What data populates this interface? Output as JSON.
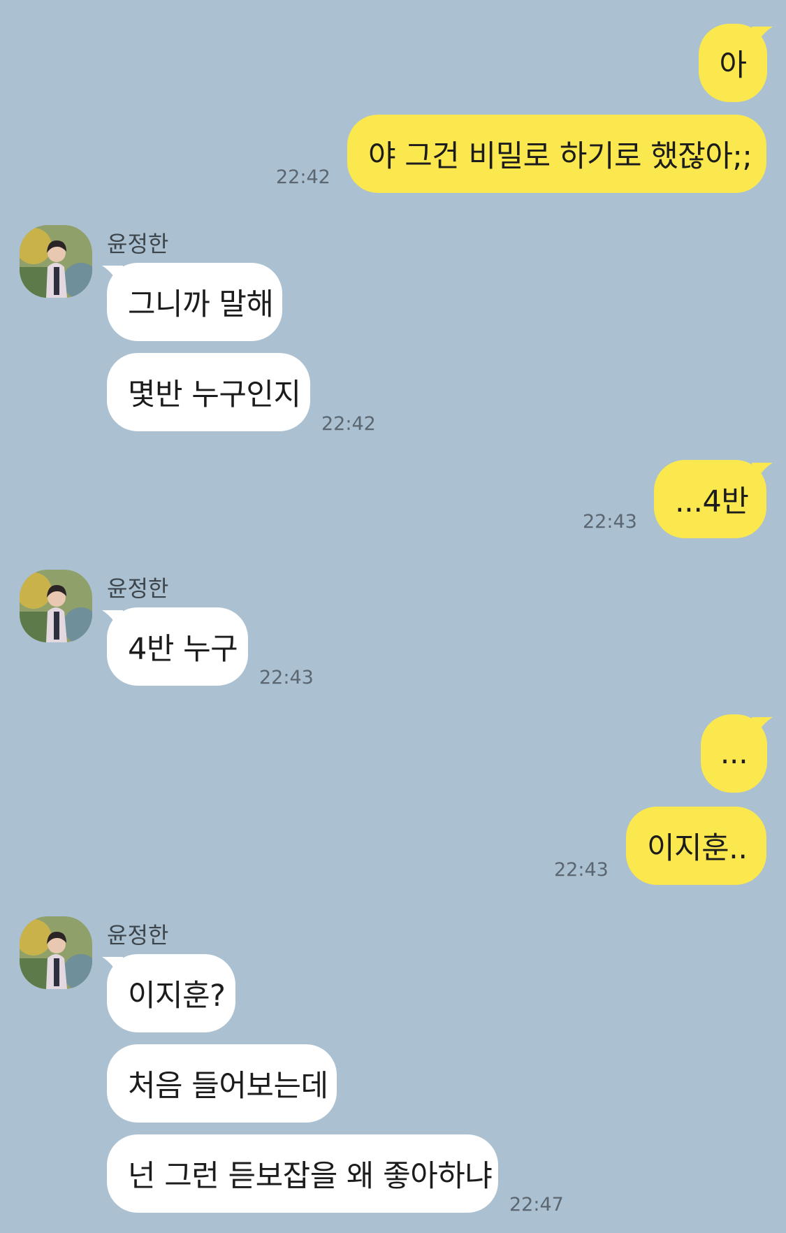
{
  "conversation": {
    "messages": [
      {
        "sender": "me",
        "text": "아"
      },
      {
        "sender": "me",
        "text": "야 그건 비밀로 하기로 했잖아;;",
        "time": "22:42"
      },
      {
        "sender": "윤정한",
        "text": "그니까 말해"
      },
      {
        "sender": "윤정한",
        "text": "몇반 누구인지",
        "time": "22:42"
      },
      {
        "sender": "me",
        "text": "...4반",
        "time": "22:43"
      },
      {
        "sender": "윤정한",
        "text": "4반 누구",
        "time": "22:43"
      },
      {
        "sender": "me",
        "text": "..."
      },
      {
        "sender": "me",
        "text": "이지훈..",
        "time": "22:43"
      },
      {
        "sender": "윤정한",
        "text": "이지훈?"
      },
      {
        "sender": "윤정한",
        "text": "처음 들어보는데"
      },
      {
        "sender": "윤정한",
        "text": "넌 그런 듣보잡을 왜 좋아하냐",
        "time": "22:47"
      }
    ],
    "groups": [
      {
        "sender_name": "윤정한",
        "avatar_icon": "profile-photo"
      },
      {
        "sender_name": "윤정한",
        "avatar_icon": "profile-photo"
      },
      {
        "sender_name": "윤정한",
        "avatar_icon": "profile-photo"
      }
    ]
  },
  "colors": {
    "background": "#abc1d1",
    "my_bubble": "#fae84e",
    "their_bubble": "#ffffff",
    "timestamp": "#5b6670"
  }
}
